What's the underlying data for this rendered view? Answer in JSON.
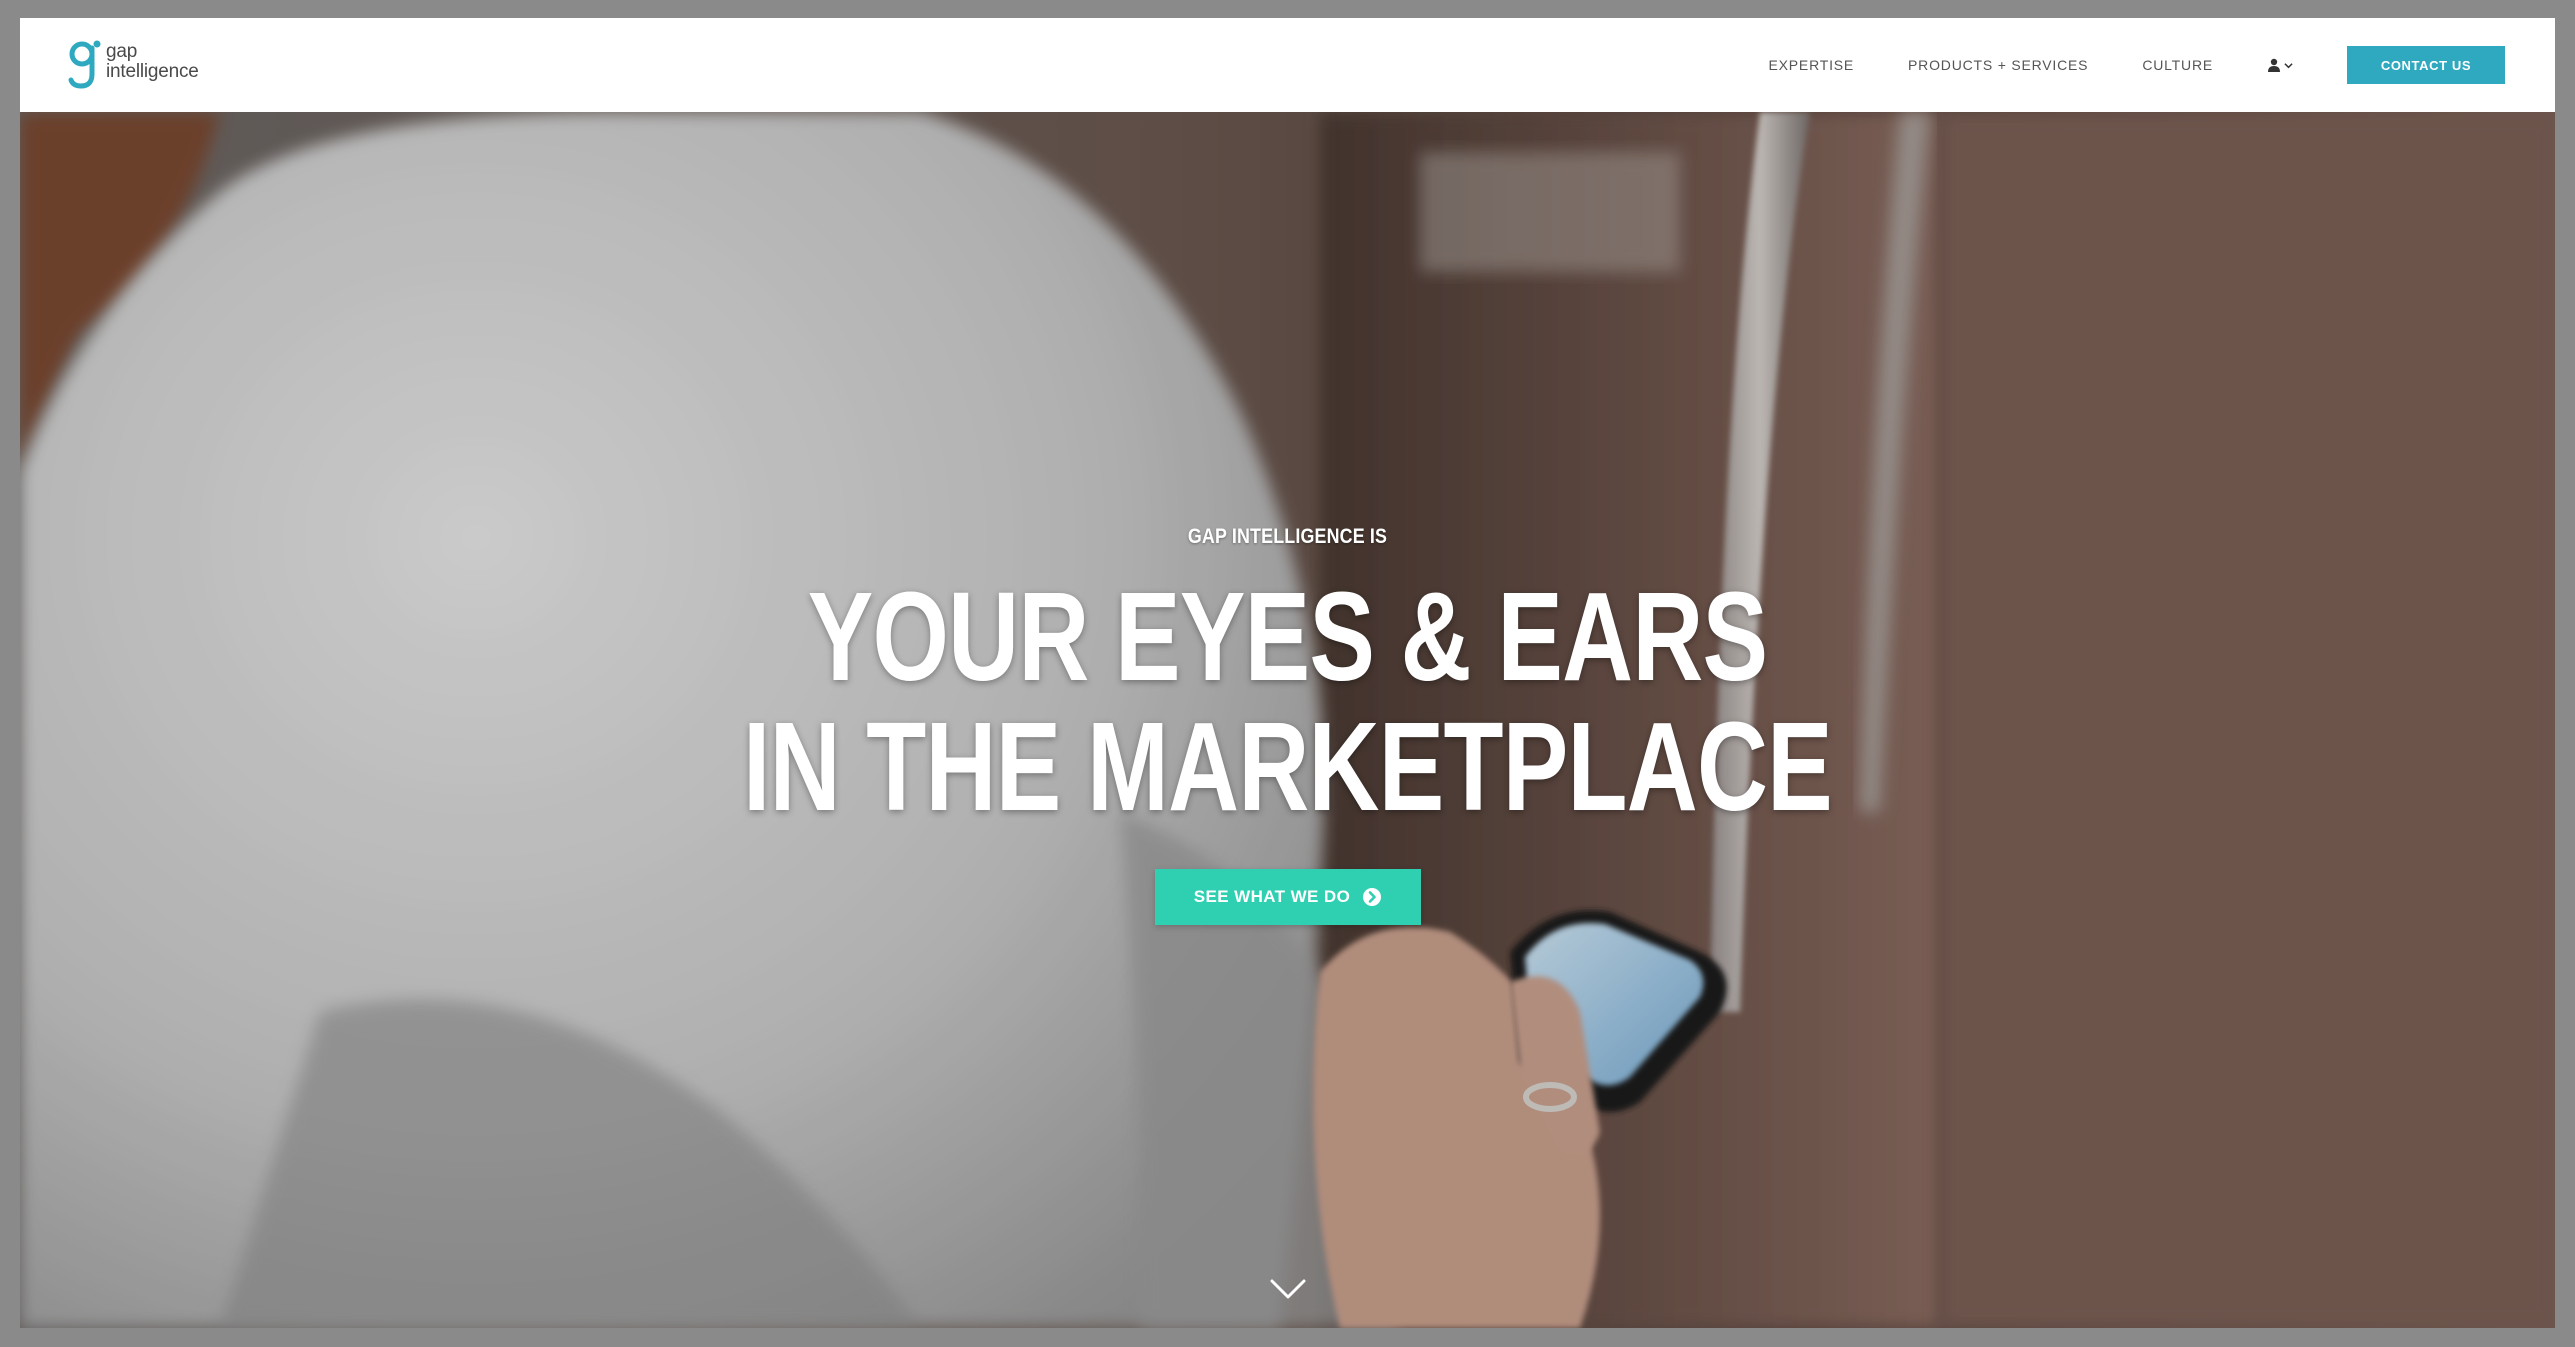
{
  "brand": {
    "logo_line1": "gap",
    "logo_line2": "intelligence",
    "accent_color": "#2ea9bf",
    "cta_color": "#2fd0b2"
  },
  "nav": {
    "items": [
      {
        "label": "EXPERTISE"
      },
      {
        "label": "PRODUCTS + SERVICES"
      },
      {
        "label": "CULTURE"
      }
    ],
    "user_icon": "user-icon",
    "contact_label": "CONTACT US"
  },
  "hero": {
    "eyebrow": "GAP INTELLIGENCE IS",
    "headline_line1": "YOUR EYES & EARS",
    "headline_line2": "IN THE MARKETPLACE",
    "cta_label": "SEE WHAT WE DO",
    "cta_icon": "arrow-circle-right-icon",
    "scroll_icon": "chevron-down-icon"
  }
}
